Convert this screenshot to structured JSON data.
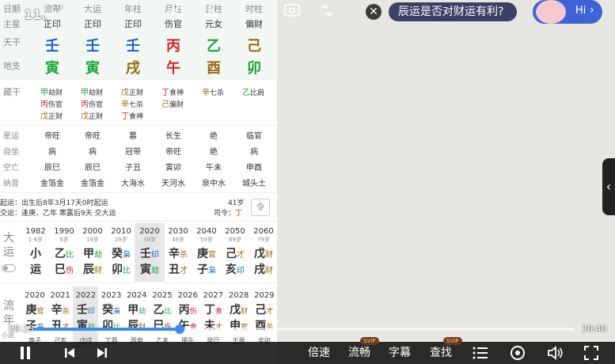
{
  "chart": {
    "header_labels": [
      "日期",
      "流年",
      "大运",
      "年柱",
      "月柱",
      "日柱",
      "时柱"
    ],
    "row_labels": {
      "main_star": "主星",
      "stem": "天干",
      "branch": "地支",
      "hidden": "藏干",
      "star_luck": "星运",
      "self_seat": "自坐",
      "void": "空亡",
      "nayin": "纳音"
    },
    "columns": [
      {
        "star": "正印",
        "stem": "壬",
        "stem_color": "#1d63c8",
        "branch": "寅",
        "branch_color": "#1aa53a"
      },
      {
        "star": "正印",
        "stem": "壬",
        "stem_color": "#1d63c8",
        "branch": "寅",
        "branch_color": "#1aa53a"
      },
      {
        "star": "正印",
        "stem": "壬",
        "stem_color": "#1d63c8",
        "branch": "戌",
        "branch_color": "#9a6a10"
      },
      {
        "star": "伤官",
        "stem": "丙",
        "stem_color": "#d0262c",
        "branch": "午",
        "branch_color": "#d0262c"
      },
      {
        "star": "元女",
        "stem": "乙",
        "stem_color": "#1aa53a",
        "branch": "酉",
        "branch_color": "#9a6a10"
      },
      {
        "star": "偏财",
        "stem": "己",
        "stem_color": "#9a6a10",
        "branch": "卯",
        "branch_color": "#1aa53a"
      }
    ],
    "hidden_stems": [
      [
        {
          "g": "甲",
          "c": "#1aa53a",
          "t": "劫财"
        },
        {
          "g": "丙",
          "c": "#d0262c",
          "t": "伤官"
        },
        {
          "g": "戊",
          "c": "#9a6a10",
          "t": "正财"
        }
      ],
      [
        {
          "g": "甲",
          "c": "#1aa53a",
          "t": "劫财"
        },
        {
          "g": "丙",
          "c": "#d0262c",
          "t": "伤官"
        },
        {
          "g": "戊",
          "c": "#9a6a10",
          "t": "正财"
        }
      ],
      [
        {
          "g": "戊",
          "c": "#9a6a10",
          "t": "正财"
        },
        {
          "g": "辛",
          "c": "#9a6a10",
          "t": "七杀"
        },
        {
          "g": "丁",
          "c": "#d0262c",
          "t": "食神"
        }
      ],
      [
        {
          "g": "丁",
          "c": "#d0262c",
          "t": "食神"
        },
        {
          "g": "己",
          "c": "#9a6a10",
          "t": "偏财"
        }
      ],
      [
        {
          "g": "辛",
          "c": "#9a6a10",
          "t": "七杀"
        }
      ],
      [
        {
          "g": "乙",
          "c": "#1aa53a",
          "t": "比肩"
        }
      ]
    ],
    "star_luck": [
      "帝旺",
      "帝旺",
      "墓",
      "长生",
      "绝",
      "临官"
    ],
    "self_seat": [
      "病",
      "病",
      "冠带",
      "帝旺",
      "绝",
      "病"
    ],
    "void": [
      "辰巳",
      "辰巳",
      "子丑",
      "寅卯",
      "午未",
      "申酉"
    ],
    "nayin": [
      "金箔金",
      "金箔金",
      "大海水",
      "天河水",
      "泉中水",
      "城头土"
    ],
    "start_luck": "起运：出生后8年3月17天0时起运",
    "handover": "交运：逢庚、乙年 寒露后9天 交大运",
    "age": "41岁",
    "siling_label": "司令：",
    "siling_value": "丁",
    "dayun_label": [
      "大",
      "运"
    ],
    "dayun": [
      {
        "year": "1982",
        "age": "1-8岁",
        "g": "小",
        "z": "运",
        "gt": "",
        "zt": "",
        "sel": false
      },
      {
        "year": "1990",
        "age": "9岁",
        "g": "乙",
        "z": "巳",
        "gt": "比",
        "zt": "伤",
        "sel": false
      },
      {
        "year": "2000",
        "age": "19岁",
        "g": "甲",
        "z": "辰",
        "gt": "劫",
        "zt": "财",
        "sel": false
      },
      {
        "year": "2010",
        "age": "29岁",
        "g": "癸",
        "z": "卯",
        "gt": "枭",
        "zt": "比",
        "sel": false
      },
      {
        "year": "2020",
        "age": "39岁",
        "g": "壬",
        "z": "寅",
        "gt": "印",
        "zt": "劫",
        "sel": true
      },
      {
        "year": "2030",
        "age": "49岁",
        "g": "辛",
        "z": "丑",
        "gt": "杀",
        "zt": "才",
        "sel": false
      },
      {
        "year": "2040",
        "age": "59岁",
        "g": "庚",
        "z": "子",
        "gt": "官",
        "zt": "枭",
        "sel": false
      },
      {
        "year": "2050",
        "age": "69岁",
        "g": "己",
        "z": "亥",
        "gt": "才",
        "zt": "印",
        "sel": false
      },
      {
        "year": "2060",
        "age": "79岁",
        "g": "戊",
        "z": "戌",
        "gt": "财",
        "zt": "财",
        "sel": false
      }
    ],
    "liunian_label": [
      "流",
      "年"
    ],
    "liunian_sub": "小运",
    "liunian": [
      {
        "year": "2020",
        "g": "庚",
        "z": "子",
        "gt": "官",
        "zt": "枭",
        "xy": "庚子",
        "sel": false
      },
      {
        "year": "2021",
        "g": "辛",
        "z": "丑",
        "gt": "杀",
        "zt": "才",
        "xy": "己亥",
        "sel": false
      },
      {
        "year": "2022",
        "g": "壬",
        "z": "寅",
        "gt": "印",
        "zt": "劫",
        "xy": "戊戌",
        "sel": true
      },
      {
        "year": "2023",
        "g": "癸",
        "z": "卯",
        "gt": "枭",
        "zt": "比",
        "xy": "丁酉",
        "sel": false
      },
      {
        "year": "2024",
        "g": "甲",
        "z": "辰",
        "gt": "劫",
        "zt": "财",
        "xy": "丙申",
        "sel": false
      },
      {
        "year": "2025",
        "g": "乙",
        "z": "巳",
        "gt": "比",
        "zt": "伤",
        "xy": "乙未",
        "sel": false
      },
      {
        "year": "2026",
        "g": "丙",
        "z": "午",
        "gt": "伤",
        "zt": "食",
        "xy": "甲午",
        "sel": false
      },
      {
        "year": "2027",
        "g": "丁",
        "z": "未",
        "gt": "食",
        "zt": "才",
        "xy": "癸巳",
        "sel": false
      },
      {
        "year": "2028",
        "g": "戊",
        "z": "申",
        "gt": "财",
        "zt": "官",
        "xy": "壬辰",
        "sel": false
      },
      {
        "year": "2029",
        "g": "己",
        "z": "酉",
        "gt": "才",
        "zt": "杀",
        "xy": "辛卯",
        "sel": false
      }
    ]
  },
  "player": {
    "time_indicator": "11、",
    "question": "辰运是否对财运有利?",
    "hi": "Hi",
    "current_time": "08:23",
    "total_time": "30:40",
    "progress": 0.273,
    "controls": {
      "speed": "倍速",
      "quality": "流畅",
      "subtitle": "字幕",
      "search": "查找",
      "svip": "SVIP"
    }
  },
  "colors": {
    "accent_blue": "#3a8ef0",
    "pill_blue": "#3e63d6"
  }
}
